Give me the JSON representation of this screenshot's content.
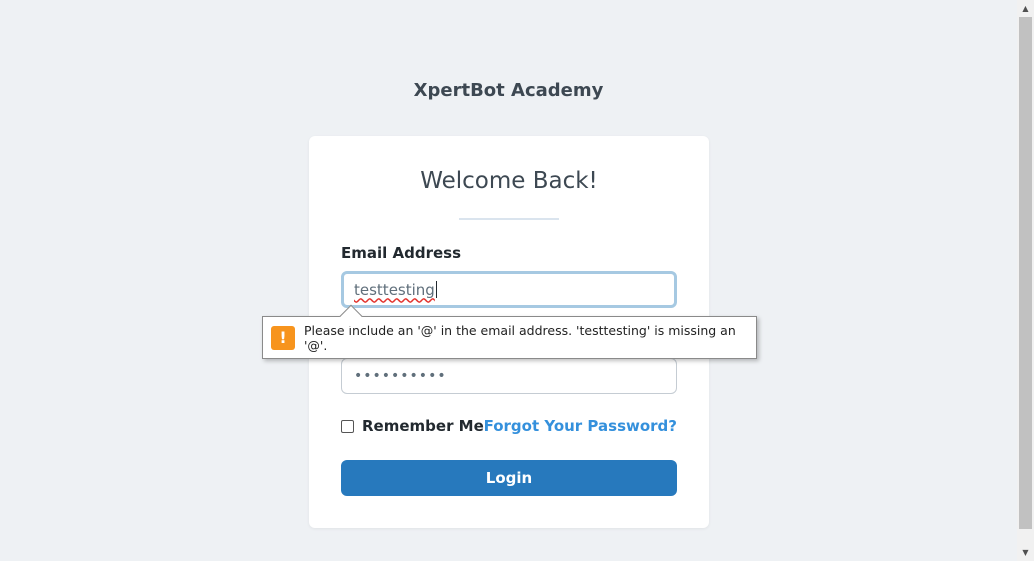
{
  "brand": {
    "title": "XpertBot Academy"
  },
  "login_card": {
    "heading": "Welcome Back!",
    "email_label": "Email Address",
    "email_value": "testtesting",
    "password_masked": "••••••••••",
    "remember_label": "Remember Me",
    "forgot_link": "Forgot Your Password?",
    "login_button": "Login"
  },
  "validation_tooltip": {
    "icon": "warning-icon",
    "icon_glyph": "!",
    "message": "Please include an '@' in the email address. 'testtesting' is missing an '@'."
  },
  "scrollbar": {
    "up_glyph": "▲",
    "down_glyph": "▼"
  },
  "colors": {
    "background": "#eef1f4",
    "primary_button": "#2779bd",
    "link": "#3490dc",
    "warning": "#f7941d"
  }
}
